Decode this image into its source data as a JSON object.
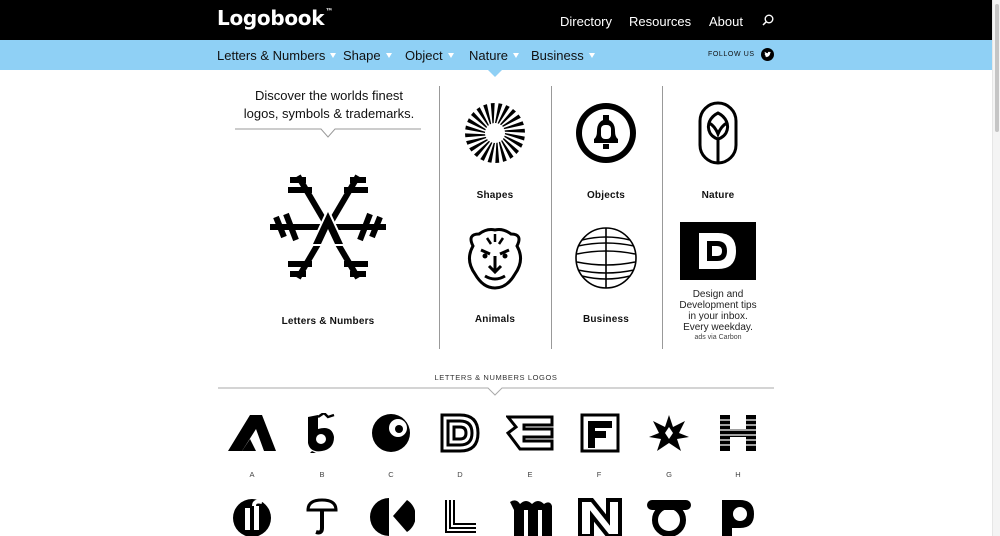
{
  "header": {
    "brand": "Logobook",
    "trademark": "™",
    "nav": [
      "Directory",
      "Resources",
      "About"
    ],
    "search_icon": "search-icon"
  },
  "subnav": {
    "categories": [
      "Letters & Numbers",
      "Shape",
      "Object",
      "Nature",
      "Business"
    ],
    "follow_label": "FOLLOW US",
    "social_icon": "twitter-icon",
    "background": "#8fd0f5"
  },
  "hero": {
    "tagline_line1": "Discover the worlds finest",
    "tagline_line2": "logos, symbols & trademarks.",
    "featured_label": "Letters & Numbers"
  },
  "tiles": [
    "Shapes",
    "Objects",
    "Nature",
    "Animals",
    "Business"
  ],
  "ad": {
    "line1": "Design and",
    "line2": "Development tips",
    "line3": "in your inbox.",
    "line4": "Every weekday.",
    "via": "ads via Carbon"
  },
  "section": {
    "title": "LETTERS & NUMBERS LOGOS",
    "letters": [
      "A",
      "B",
      "C",
      "D",
      "E",
      "F",
      "G",
      "H"
    ]
  }
}
